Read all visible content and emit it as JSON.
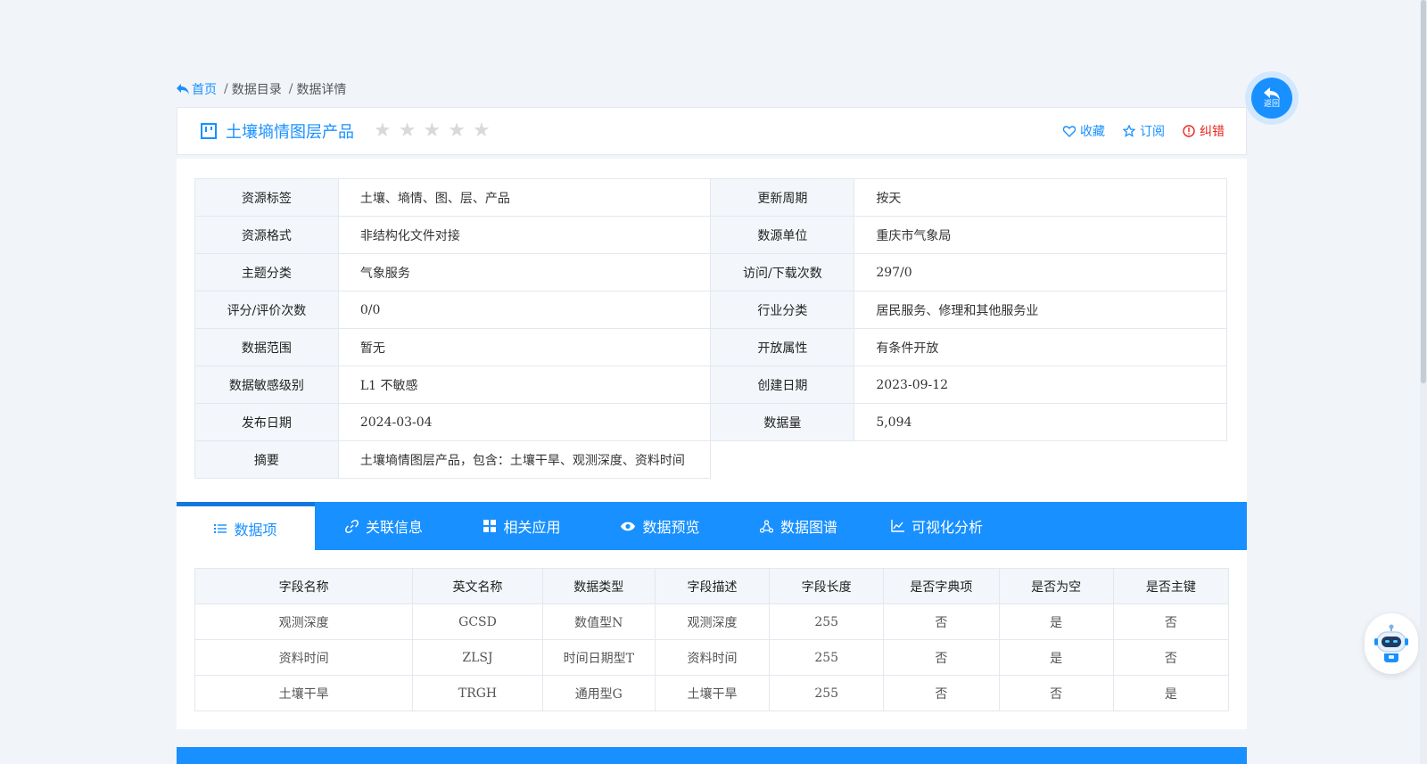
{
  "breadcrumb": {
    "home": "首页",
    "items": [
      "数据目录",
      "数据详情"
    ]
  },
  "title": {
    "name": "土壤墒情图层产品",
    "rating_stars_filled": 0,
    "rating_stars_total": 5,
    "actions": {
      "favorite": "收藏",
      "subscribe": "订阅",
      "report_error": "纠错"
    }
  },
  "info": {
    "rows": [
      {
        "l1": "资源标签",
        "v1": "土壤、墒情、图、层、产品",
        "l2": "更新周期",
        "v2": "按天"
      },
      {
        "l1": "资源格式",
        "v1": "非结构化文件对接",
        "l2": "数源单位",
        "v2": "重庆市气象局"
      },
      {
        "l1": "主题分类",
        "v1": "气象服务",
        "l2": "访问/下载次数",
        "v2": "297/0"
      },
      {
        "l1": "评分/评价次数",
        "v1": "0/0",
        "l2": "行业分类",
        "v2": "居民服务、修理和其他服务业"
      },
      {
        "l1": "数据范围",
        "v1": "暂无",
        "l2": "开放属性",
        "v2": "有条件开放"
      },
      {
        "l1": "数据敏感级别",
        "v1": "L1 不敏感",
        "l2": "创建日期",
        "v2": "2023-09-12"
      },
      {
        "l1": "发布日期",
        "v1": "2024-03-04",
        "l2": "数据量",
        "v2": "5,094"
      }
    ],
    "summary_label": "摘要",
    "summary_value": "土壤墒情图层产品，包含：土壤干旱、观测深度、资料时间"
  },
  "tabs": [
    {
      "label": "数据项",
      "active": true
    },
    {
      "label": "关联信息"
    },
    {
      "label": "相关应用"
    },
    {
      "label": "数据预览"
    },
    {
      "label": "数据图谱"
    },
    {
      "label": "可视化分析"
    }
  ],
  "fields": {
    "headers": [
      "字段名称",
      "英文名称",
      "数据类型",
      "字段描述",
      "字段长度",
      "是否字典项",
      "是否为空",
      "是否主键"
    ],
    "rows": [
      [
        "观测深度",
        "GCSD",
        "数值型N",
        "观测深度",
        "255",
        "否",
        "是",
        "否"
      ],
      [
        "资料时间",
        "ZLSJ",
        "时间日期型T",
        "资料时间",
        "255",
        "否",
        "是",
        "否"
      ],
      [
        "土壤干旱",
        "TRGH",
        "通用型G",
        "土壤干旱",
        "255",
        "否",
        "否",
        "是"
      ]
    ]
  },
  "back_button": {
    "label": "返回"
  },
  "colors": {
    "accent": "#1890ff",
    "error": "#e8261c",
    "page_bg": "#f1f5fa"
  }
}
